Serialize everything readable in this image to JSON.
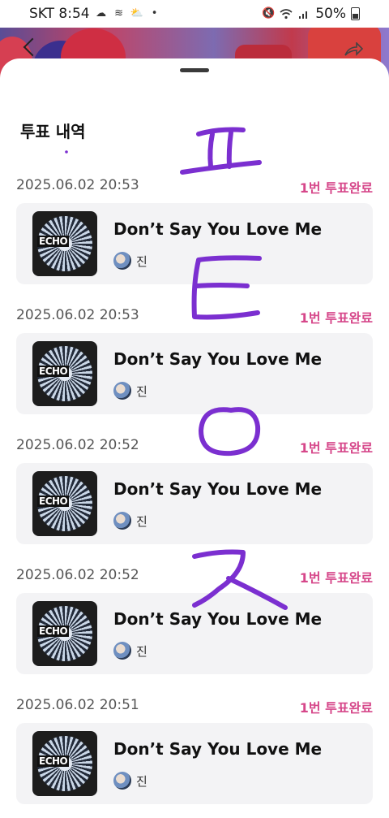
{
  "statusbar": {
    "carrier_time": "SKT 8:54",
    "battery": "50%",
    "left_icons": [
      "cloud-icon",
      "weather-icon",
      "cloud-sun-icon",
      "dot-icon"
    ],
    "right_icons": [
      "mute-icon",
      "wifi-icon",
      "signal-icon",
      "battery-icon"
    ]
  },
  "sheet": {
    "title": "투표 내역"
  },
  "entries": [
    {
      "date": "2025.06.02 20:53",
      "status": "1번 투표완료",
      "song": "Don’t Say You Love Me",
      "artist": "진",
      "album_logo": "ECHO"
    },
    {
      "date": "2025.06.02 20:53",
      "status": "1번 투표완료",
      "song": "Don’t Say You Love Me",
      "artist": "진",
      "album_logo": "ECHO"
    },
    {
      "date": "2025.06.02 20:52",
      "status": "1번 투표완료",
      "song": "Don’t Say You Love Me",
      "artist": "진",
      "album_logo": "ECHO"
    },
    {
      "date": "2025.06.02 20:52",
      "status": "1번 투표완료",
      "song": "Don’t Say You Love Me",
      "artist": "진",
      "album_logo": "ECHO"
    },
    {
      "date": "2025.06.02 20:51",
      "status": "1번 투표완료",
      "song": "Don’t Say You Love Me",
      "artist": "진",
      "album_logo": "ECHO"
    }
  ],
  "colors": {
    "accent": "#d6478a",
    "card_bg": "#f3f3f5",
    "handwriting": "#7b2fd0"
  }
}
